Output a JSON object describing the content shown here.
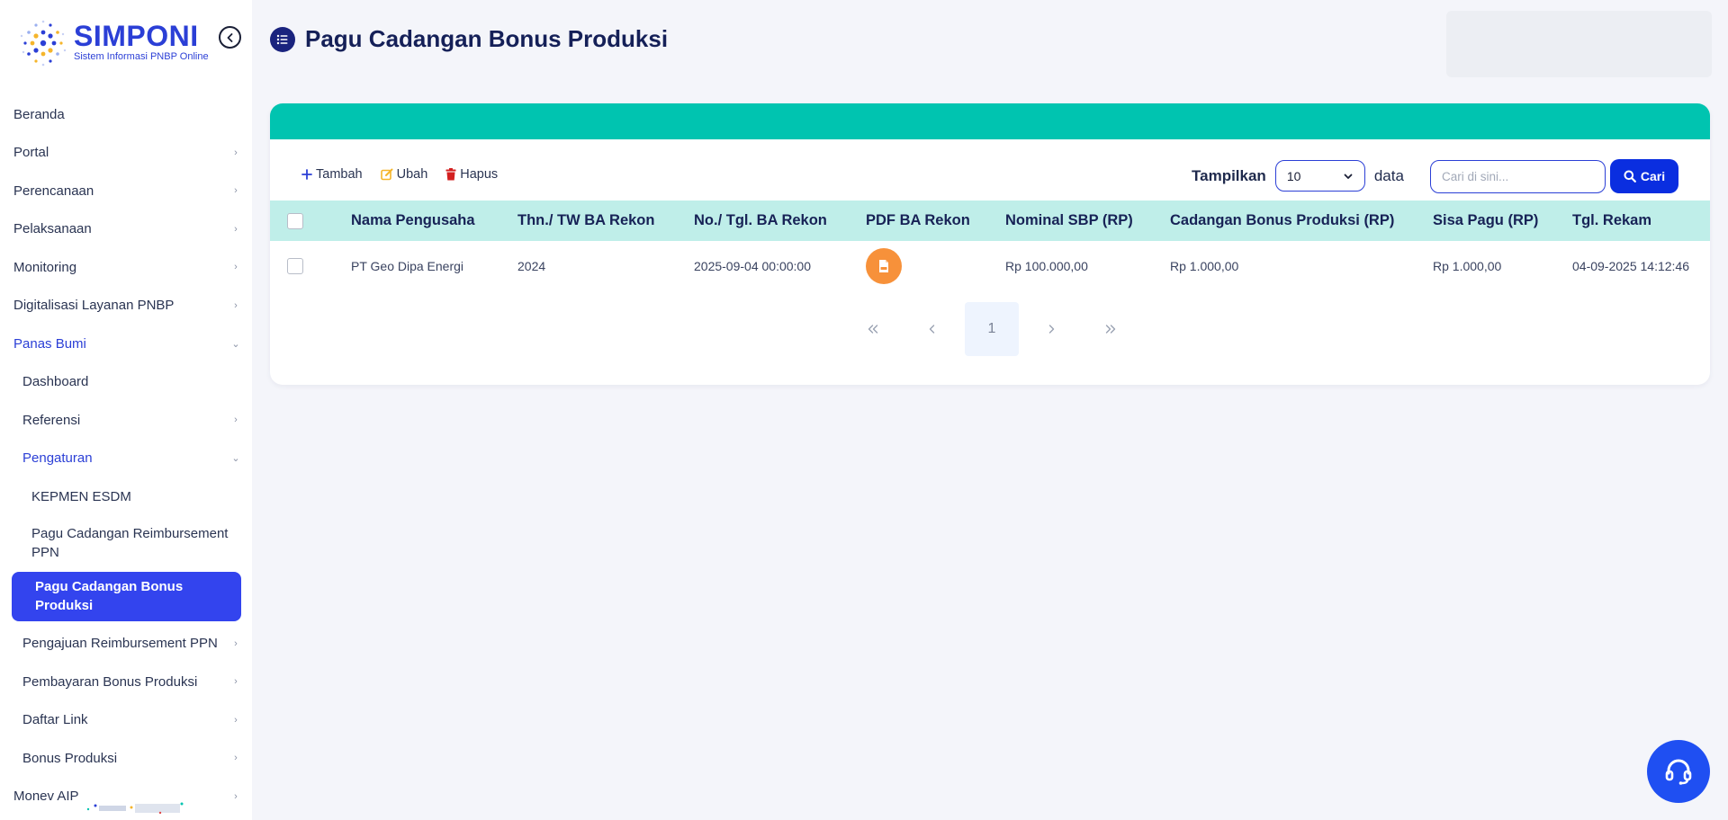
{
  "brand": {
    "name": "SIMPONI",
    "subtitle": "Sistem Informasi PNBP Online"
  },
  "sidebar": {
    "items": [
      {
        "label": "Beranda",
        "level": 0
      },
      {
        "label": "Portal",
        "level": 0
      },
      {
        "label": "Perencanaan",
        "level": 0
      },
      {
        "label": "Pelaksanaan",
        "level": 0
      },
      {
        "label": "Monitoring",
        "level": 0
      },
      {
        "label": "Digitalisasi Layanan PNBP",
        "level": 0
      },
      {
        "label": "Panas Bumi",
        "level": 0,
        "open": true
      },
      {
        "label": "Dashboard",
        "level": 1
      },
      {
        "label": "Referensi",
        "level": 1
      },
      {
        "label": "Pengaturan",
        "level": 1,
        "open": true
      },
      {
        "label": "KEPMEN ESDM",
        "level": 2
      },
      {
        "label": "Pagu Cadangan Reimbursement PPN",
        "level": 2
      },
      {
        "label": "Pagu Cadangan Bonus Produksi",
        "level": 2,
        "active": true
      },
      {
        "label": "Pengajuan Reimbursement PPN",
        "level": 1
      },
      {
        "label": "Pembayaran Bonus Produksi",
        "level": 1
      },
      {
        "label": "Daftar Link",
        "level": 1
      },
      {
        "label": "Bonus Produksi",
        "level": 1
      },
      {
        "label": "Monev AIP",
        "level": 0
      }
    ]
  },
  "page": {
    "title": "Pagu Cadangan Bonus Produksi"
  },
  "toolbar": {
    "add_label": "Tambah",
    "edit_label": "Ubah",
    "delete_label": "Hapus"
  },
  "display": {
    "label": "Tampilkan",
    "selected": "10",
    "suffix": "data"
  },
  "search": {
    "placeholder": "Cari di sini...",
    "button_label": "Cari"
  },
  "table": {
    "columns": [
      "Nama Pengusaha",
      "Thn./ TW BA Rekon",
      "No./ Tgl. BA Rekon",
      "PDF BA Rekon",
      "Nominal SBP (RP)",
      "Cadangan Bonus Produksi (RP)",
      "Sisa Pagu (RP)",
      "Tgl. Rekam"
    ],
    "rows": [
      {
        "nama_pengusaha": "PT Geo Dipa Energi",
        "tahun_tw": "2024",
        "no_tgl": "2025-09-04 00:00:00",
        "nominal_sbp": "Rp 100.000,00",
        "cadangan": "Rp 1.000,00",
        "sisa_pagu": "Rp 1.000,00",
        "tgl_rekam": "04-09-2025 14:12:46"
      }
    ]
  },
  "pagination": {
    "current": "1"
  },
  "colors": {
    "primary": "#2b3fd6",
    "teal": "#00c4b0",
    "pdf": "#f7913a",
    "active_nav": "#3344ee"
  },
  "icons": {
    "collapse": "chevron-left-circle-icon",
    "header": "list-icon",
    "add": "plus-icon",
    "edit": "edit-icon",
    "delete": "trash-icon",
    "search": "search-icon",
    "pdf": "pdf-file-icon",
    "help": "headset-icon"
  }
}
